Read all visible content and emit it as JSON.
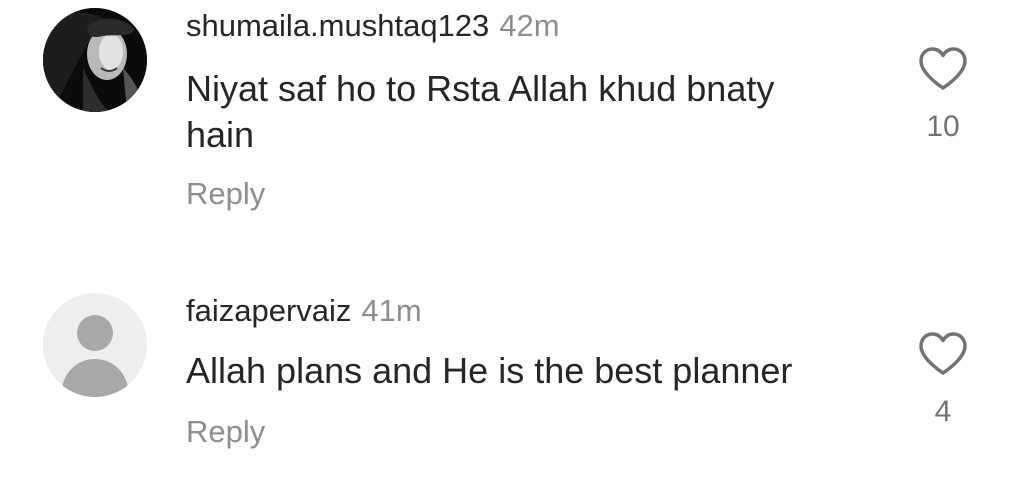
{
  "comments": [
    {
      "username": "shumaila.mushtaq123",
      "time": "42m",
      "text_line1": "Niyat saf ho to Rsta Allah khud bnaty",
      "text_line2": "hain",
      "reply_label": "Reply",
      "likes": "10",
      "avatar": "profile-photo"
    },
    {
      "username": "faizapervaiz",
      "time": "41m",
      "text_line1": "Allah plans and He is the best planner",
      "reply_label": "Reply",
      "likes": "4",
      "avatar": "default-avatar"
    }
  ],
  "colors": {
    "text": "#262626",
    "secondary": "#8e8e8e",
    "icon": "#737373",
    "avatar_bg": "#eeeeee",
    "avatar_glyph": "#a8a8a8"
  },
  "icons": [
    "heart-icon",
    "default-avatar-icon"
  ]
}
